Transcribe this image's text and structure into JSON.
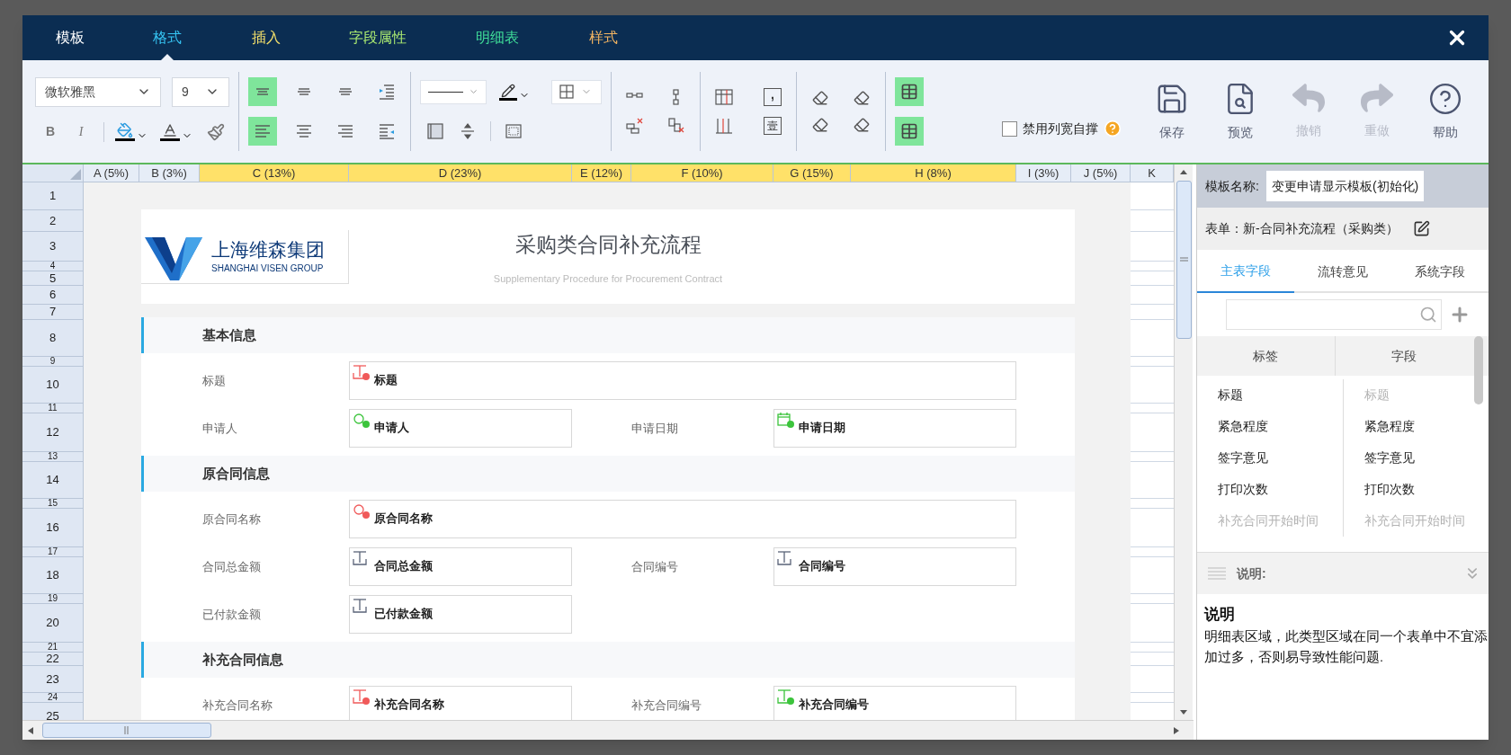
{
  "tabs": [
    {
      "label": "模板",
      "selected": false,
      "color": "#ffffff"
    },
    {
      "label": "格式",
      "selected": true,
      "color": "#36c5f4"
    },
    {
      "label": "插入",
      "selected": false,
      "color": "#f4e06a"
    },
    {
      "label": "字段属性",
      "selected": false,
      "color": "#a9e871"
    },
    {
      "label": "明细表",
      "selected": false,
      "color": "#3fdc98"
    },
    {
      "label": "样式",
      "selected": false,
      "color": "#f2b462"
    }
  ],
  "toolbar": {
    "font": "微软雅黑",
    "size": "9",
    "bold": "B",
    "italic": "I",
    "thousands": ",",
    "uppercase": "壹",
    "align_buttons": [
      {
        "selected": true
      },
      {
        "selected": false
      },
      {
        "selected": false
      },
      {
        "selected": false
      },
      {
        "selected": true
      },
      {
        "selected": false
      },
      {
        "selected": false
      },
      {
        "selected": false
      }
    ],
    "table_buttons": [
      {
        "selected": true
      },
      {
        "selected": true
      }
    ],
    "checkbox": {
      "label": "禁用列宽自撑",
      "checked": false
    },
    "actions": [
      {
        "label": "保存",
        "disabled": false
      },
      {
        "label": "预览",
        "disabled": false
      },
      {
        "label": "撤销",
        "disabled": true
      },
      {
        "label": "重做",
        "disabled": true
      },
      {
        "label": "帮助",
        "disabled": false
      }
    ]
  },
  "sheet": {
    "columns": [
      {
        "label": "A (5%)",
        "highlighted": false
      },
      {
        "label": "B (3%)",
        "highlighted": false
      },
      {
        "label": "C (13%)",
        "highlighted": true
      },
      {
        "label": "D (23%)",
        "highlighted": true
      },
      {
        "label": "E (12%)",
        "highlighted": true
      },
      {
        "label": "F (10%)",
        "highlighted": true
      },
      {
        "label": "G (15%)",
        "highlighted": true
      },
      {
        "label": "H (8%)",
        "highlighted": true
      },
      {
        "label": "I (3%)",
        "highlighted": false
      },
      {
        "label": "J (5%)",
        "highlighted": false
      },
      {
        "label": "K",
        "highlighted": false
      }
    ],
    "rows": [
      "1",
      "2",
      "3",
      "4",
      "5",
      "6",
      "7",
      "8",
      "9",
      "10",
      "11",
      "12",
      "13",
      "14",
      "15",
      "16",
      "17",
      "18",
      "19",
      "20",
      "21",
      "22",
      "23",
      "24",
      "25"
    ]
  },
  "form": {
    "logo_name": "上海维森集团",
    "logo_sub": "SHANGHAI VISEN GROUP",
    "title": "采购类合同补充流程",
    "subtitle": "Supplementary Procedure for Procurement Contract",
    "sections": [
      {
        "title": "基本信息",
        "rows": [
          [
            {
              "label": "标题",
              "value": "标题",
              "kind": "text",
              "color": "#f05a5a",
              "wide": true
            }
          ],
          [
            {
              "label": "申请人",
              "value": "申请人",
              "kind": "search",
              "color": "#3cc43c",
              "wide": false
            },
            {
              "label": "申请日期",
              "value": "申请日期",
              "kind": "date",
              "color": "#3cc43c"
            }
          ]
        ]
      },
      {
        "title": "原合同信息",
        "rows": [
          [
            {
              "label": "原合同名称",
              "value": "原合同名称",
              "kind": "search",
              "color": "#f05a5a",
              "wide": true
            }
          ],
          [
            {
              "label": "合同总金额",
              "value": "合同总金额",
              "kind": "text",
              "wide": false
            },
            {
              "label": "合同编号",
              "value": "合同编号",
              "kind": "text"
            }
          ],
          [
            {
              "label": "已付款金额",
              "value": "已付款金额",
              "kind": "text",
              "wide": false
            }
          ]
        ]
      },
      {
        "title": "补充合同信息",
        "rows": [
          [
            {
              "label": "补充合同名称",
              "value": "补充合同名称",
              "kind": "text",
              "color": "#f05a5a",
              "wide": false
            },
            {
              "label": "补充合同编号",
              "value": "补充合同编号",
              "kind": "text",
              "color": "#3cc43c"
            }
          ]
        ]
      }
    ]
  },
  "panel": {
    "template_label": "模板名称:",
    "template_name": "变更申请显示模板(初始化)",
    "form_label": "表单：新-合同补充流程（采购类）",
    "tabs": [
      {
        "label": "主表字段",
        "selected": true
      },
      {
        "label": "流转意见",
        "selected": false
      },
      {
        "label": "系统字段",
        "selected": false
      }
    ],
    "columns": [
      "标签",
      "字段"
    ],
    "rows": [
      {
        "label": {
          "text": "标题",
          "disabled": false
        },
        "field": {
          "text": "标题",
          "disabled": true
        }
      },
      {
        "label": {
          "text": "紧急程度",
          "disabled": false
        },
        "field": {
          "text": "紧急程度",
          "disabled": false
        }
      },
      {
        "label": {
          "text": "签字意见",
          "disabled": false
        },
        "field": {
          "text": "签字意见",
          "disabled": false
        }
      },
      {
        "label": {
          "text": "打印次数",
          "disabled": false
        },
        "field": {
          "text": "打印次数",
          "disabled": false
        }
      },
      {
        "label": {
          "text": "补充合同开始时间",
          "disabled": true
        },
        "field": {
          "text": "补充合同开始时间",
          "disabled": true
        }
      }
    ],
    "notes_header": "说明:",
    "notes_title": "说明",
    "notes_text": "明细表区域，此类型区域在同一个表单中不宜添加过多，否则易导致性能问题."
  }
}
